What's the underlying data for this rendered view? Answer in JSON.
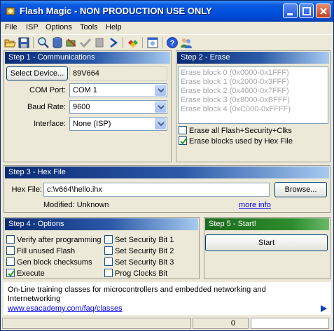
{
  "window": {
    "title": "Flash Magic - NON PRODUCTION USE ONLY"
  },
  "menu": [
    "File",
    "ISP",
    "Options",
    "Tools",
    "Help"
  ],
  "toolbar_icons": [
    "open-icon",
    "save-icon",
    "find-icon",
    "database-icon",
    "erase-icon",
    "check-icon",
    "run-icon",
    "go-icon",
    "gems-icon",
    "window-icon",
    "help-icon",
    "users-icon"
  ],
  "step1": {
    "header": "Step 1 - Communications",
    "select_device_label": "Select Device...",
    "device_value": "89V664",
    "com_port_label": "COM Port:",
    "com_port_value": "COM 1",
    "baud_rate_label": "Baud Rate:",
    "baud_rate_value": "9600",
    "interface_label": "Interface:",
    "interface_value": "None (ISP)"
  },
  "step2": {
    "header": "Step 2 - Erase",
    "blocks": [
      "Erase block 0 (0x0000-0x1FFF)",
      "Erase block 1 (0x2000-0x3FFF)",
      "Erase block 2 (0x4000-0x7FFF)",
      "Erase block 3 (0x8000-0xBFFF)",
      "Erase block 4 (0xC000-0xFFFF)"
    ],
    "erase_all_label": "Erase all Flash+Security+Clks",
    "erase_all_checked": false,
    "erase_used_label": "Erase blocks used by Hex File",
    "erase_used_checked": true
  },
  "step3": {
    "header": "Step 3 - Hex File",
    "hex_file_label": "Hex File:",
    "hex_file_value": "c:\\v664\\hello.ihx",
    "browse_label": "Browse...",
    "modified_text": "Modified: Unknown",
    "more_info_label": "more info"
  },
  "step4": {
    "header": "Step 4 - Options",
    "options": [
      {
        "label": "Verify after programming",
        "checked": false
      },
      {
        "label": "Fill unused Flash",
        "checked": false
      },
      {
        "label": "Gen block checksums",
        "checked": false
      },
      {
        "label": "Execute",
        "checked": true
      },
      {
        "label": "Set Security Bit 1",
        "checked": false
      },
      {
        "label": "Set Security Bit 2",
        "checked": false
      },
      {
        "label": "Set Security Bit 3",
        "checked": false
      },
      {
        "label": "Prog Clocks Bit",
        "checked": false
      }
    ]
  },
  "step5": {
    "header": "Step 5 - Start!",
    "start_label": "Start"
  },
  "info": {
    "text": "On-Line training classes for microcontrollers and embedded networking and Internetworking",
    "link": "www.esacademy.com/faq/classes"
  },
  "status": {
    "value": "0"
  },
  "colors": {
    "title_blue": "#0050dc",
    "header_navy": "#0a2a74",
    "header_green": "#2d8d2d",
    "link_blue": "#0000ee",
    "checkmark_green": "#21a121"
  }
}
